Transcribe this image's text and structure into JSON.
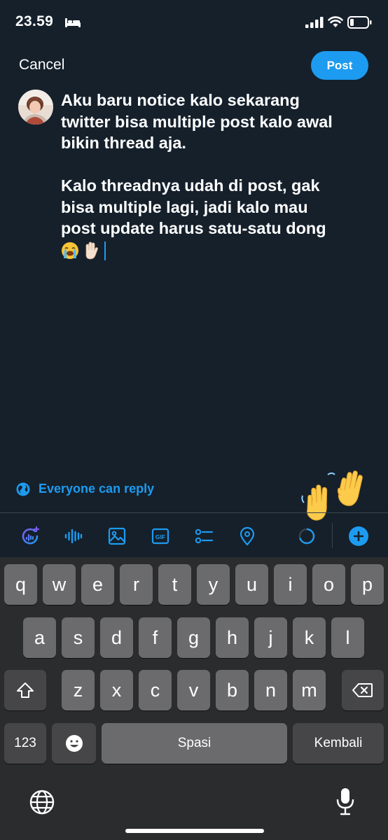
{
  "status_bar": {
    "time": "23.59",
    "icons": [
      "bed-icon",
      "signal-icon",
      "wifi-icon",
      "battery-icon"
    ]
  },
  "top_bar": {
    "cancel_label": "Cancel",
    "post_label": "Post"
  },
  "compose": {
    "lines": [
      "Aku baru notice kalo sekarang",
      "twitter bisa multiple post kalo awal",
      "bikin thread aja.",
      "",
      "Kalo threadnya udah di post, gak",
      "bisa multiple lagi, jadi kalo mau",
      "post update harus satu-satu dong"
    ],
    "trailing_emojis": [
      "loudly-crying-face-emoji",
      "raised-hand-emoji"
    ]
  },
  "reply_setting": {
    "label": "Everyone can reply",
    "icon": "globe-icon"
  },
  "toolbar": {
    "tools": [
      "grok-icon",
      "voice-icon",
      "image-icon",
      "gif-icon",
      "poll-icon",
      "location-icon",
      "progress-ring-icon",
      "add-icon"
    ]
  },
  "keyboard": {
    "row1": [
      "q",
      "w",
      "e",
      "r",
      "t",
      "y",
      "u",
      "i",
      "o",
      "p"
    ],
    "row2": [
      "a",
      "s",
      "d",
      "f",
      "g",
      "h",
      "j",
      "k",
      "l"
    ],
    "row3": [
      "z",
      "x",
      "c",
      "v",
      "b",
      "n",
      "m"
    ],
    "numbers_label": "123",
    "space_label": "Spasi",
    "return_label": "Kembali"
  },
  "colors": {
    "background": "#15202b",
    "accent": "#1d9bf0",
    "keyboard_bg": "#2b2c2e",
    "key_bg": "#6b6b6d",
    "key_dark_bg": "#464648"
  }
}
